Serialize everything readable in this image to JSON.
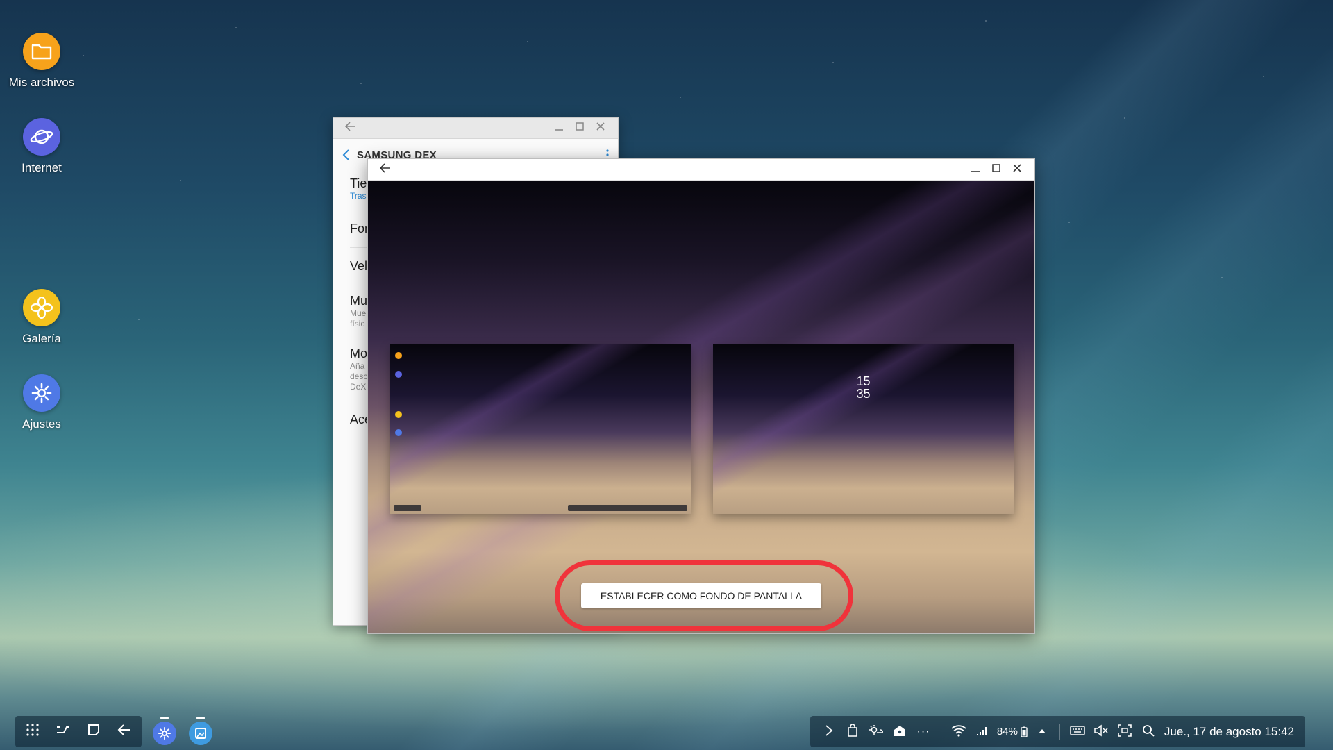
{
  "desktop": {
    "icons": [
      {
        "label": "Mis archivos",
        "icon": "folder-icon",
        "color": "#f7a21b"
      },
      {
        "label": "Internet",
        "icon": "planet-icon",
        "color": "#5b63e0"
      },
      {
        "label": "Galería",
        "icon": "flower-icon",
        "color": "#f4c21c"
      },
      {
        "label": "Ajustes",
        "icon": "gear-icon",
        "color": "#4f79e6"
      }
    ]
  },
  "settings_window": {
    "title": "SAMSUNG DEX",
    "items": [
      {
        "title": "Tie",
        "subtitle": "Tras"
      },
      {
        "title": "For",
        "subtitle": ""
      },
      {
        "title": "Vel",
        "subtitle": ""
      },
      {
        "title": "Mu",
        "subtitle_lines": [
          "Mue",
          "físic"
        ]
      },
      {
        "title": "Mo",
        "subtitle_lines": [
          "Aña",
          "desc",
          "DeX"
        ]
      },
      {
        "title": "Ace",
        "subtitle": ""
      }
    ]
  },
  "wallpaper_window": {
    "lock_preview": {
      "hour": "15",
      "minute": "35"
    },
    "set_button_label": "ESTABLECER COMO FONDO DE PANTALLA",
    "highlight_color": "#f0333b"
  },
  "taskbar": {
    "battery": "84%",
    "datetime": "Jue., 17 de agosto 15:42",
    "more": "···"
  }
}
